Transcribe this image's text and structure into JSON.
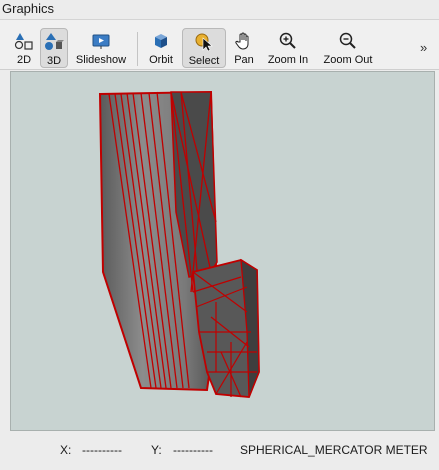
{
  "panel": {
    "title": "Graphics"
  },
  "toolbar": {
    "tools": [
      {
        "label": "2D",
        "icon": "shapes-2d-icon"
      },
      {
        "label": "3D",
        "icon": "shapes-3d-icon",
        "active": true
      },
      {
        "label": "Slideshow",
        "icon": "slideshow-icon"
      },
      {
        "label": "Orbit",
        "icon": "orbit-cube-icon"
      },
      {
        "label": "Select",
        "icon": "select-pointer-icon",
        "active": true
      },
      {
        "label": "Pan",
        "icon": "hand-icon"
      },
      {
        "label": "Zoom In",
        "icon": "zoom-in-icon"
      },
      {
        "label": "Zoom Out",
        "icon": "zoom-out-icon"
      }
    ],
    "overflow": "»"
  },
  "viewport": {
    "background": "#c8d3d1",
    "mesh_color": "#c00000",
    "surface_color": "#6e6e6e"
  },
  "status": {
    "x_label": "X:",
    "x_value": "----------",
    "y_label": "Y:",
    "y_value": "----------",
    "projection": "SPHERICAL_MERCATOR METER"
  }
}
